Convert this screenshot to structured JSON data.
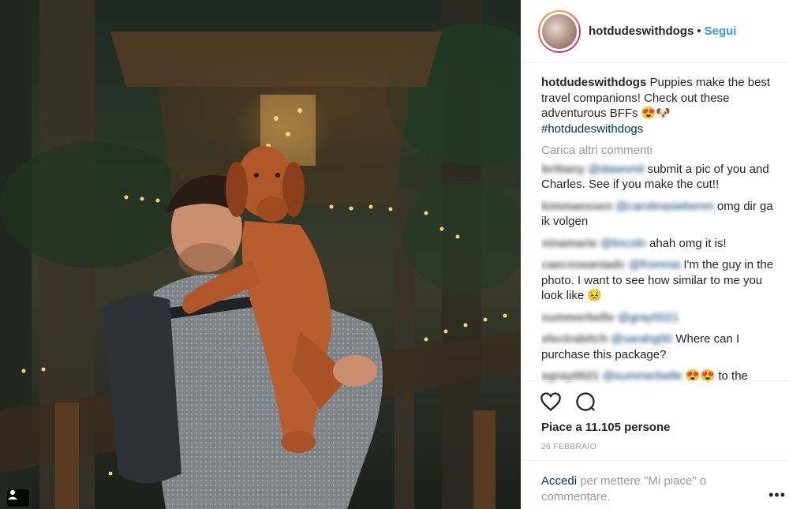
{
  "post": {
    "username": "hotdudeswithdogs",
    "dot": "•",
    "follow_label": "Segui"
  },
  "caption": {
    "username": "hotdudeswithdogs",
    "text": "Puppies make the best travel companions! Check out these adventurous BFFs 😍🐶",
    "hashtag": "#hotdudeswithdogs"
  },
  "load_more_label": "Carica altri commenti",
  "comments": [
    {
      "user": "brittany",
      "mention": "@dawnmit",
      "text": "submit a pic of you and Charles. See if you make the cut!!"
    },
    {
      "user": "kimmaessen",
      "mention": "@carolinasiebenm",
      "text": "omg dir ga ik volgen"
    },
    {
      "user": "ninamarie",
      "mention": "@lincoln",
      "text": "ahah omg it is!"
    },
    {
      "user": "caecoseaniadc",
      "mention": "@fromnia",
      "text": "I'm the guy in the photo. I want to see how similar to me you look like 😣"
    },
    {
      "user": "summerbelle",
      "mention": "@gray0021",
      "text": ""
    },
    {
      "user": "electrabitch",
      "mention": "@sarahg00",
      "text": "Where can I purchase this package?"
    },
    {
      "user": "sgray0021",
      "mention": "@summerbelle",
      "text": "😍😍 to the"
    }
  ],
  "actions": {
    "like_icon": "heart-icon",
    "comment_icon": "comment-bubble-icon",
    "likes_text": "Piace a 11.105 persone",
    "date": "26 FEBBRAIO"
  },
  "login": {
    "link": "Accedi",
    "text": "per mettere \"Mi piace\" o commentare.",
    "more": "•••"
  }
}
